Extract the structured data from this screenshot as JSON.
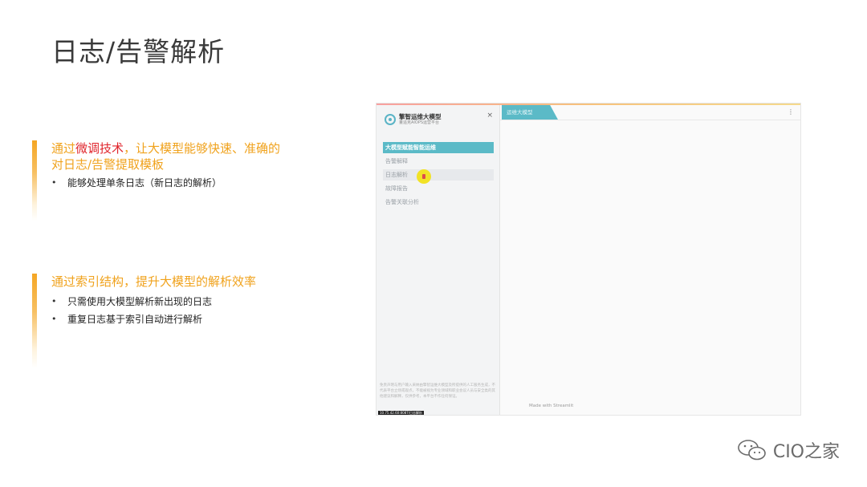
{
  "title": "日志/告警解析",
  "points": [
    {
      "heading_pre": "通过",
      "heading_highlight": "微调技术",
      "heading_post": "，让大模型能够快速、准确的",
      "heading_line2": "对日志/告警提取模板",
      "bullets": [
        "能够处理单条日志（新日志的解析）"
      ]
    },
    {
      "heading": "通过索引结构，提升大模型的解析效率",
      "bullets": [
        "只需使用大模型解析新出现的日志",
        "重复日志基于索引自动进行解析"
      ]
    }
  ],
  "app": {
    "brand_name": "擎智运维大模型",
    "brand_sub": "董遥克AIOPS运营平台",
    "close": "×",
    "nav": [
      "大模型赋能智能运维",
      "告警解释",
      "日志解析",
      "故障报告",
      "告警关联分析"
    ],
    "tab": "运维大模型",
    "disclaimer": "免责声明与用户输入采纳由擎智运维大模型及所提供的人工服务生成，不代表平台立场或观点，不能被视为专业领域和职业会议人员与安全类的其他建议和解释，仅供参考，本平台不作任何保证。",
    "ip_tag": "10.75.42.60:8087/日志解析",
    "footer": "Made with Streamlit",
    "kebab": "⋮"
  },
  "watermark": "CIO之家",
  "colors": {
    "accent": "#f0a21c",
    "highlight": "#e0252c",
    "app_accent": "#5bbac7"
  }
}
